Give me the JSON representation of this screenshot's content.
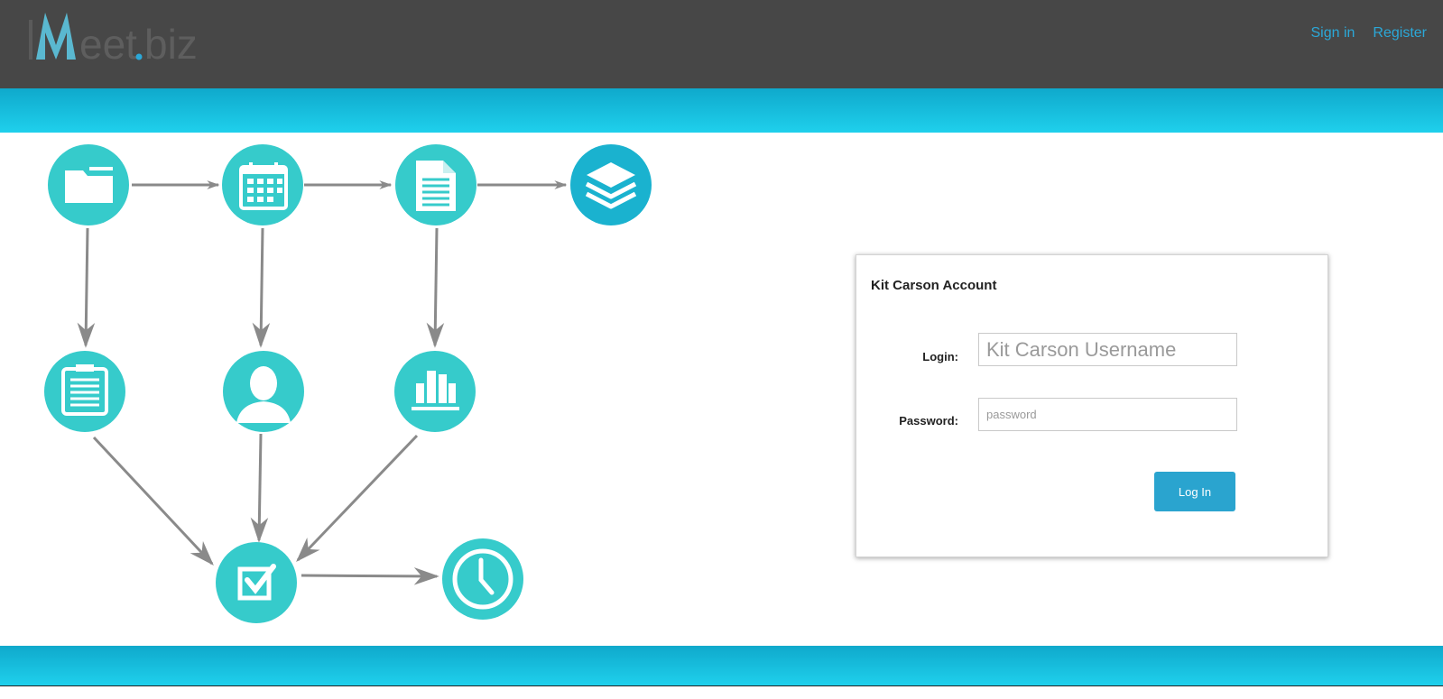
{
  "header": {
    "logo_text": "IMeet.biz",
    "nav": {
      "signin_label": "Sign in",
      "register_label": "Register"
    }
  },
  "diagram": {
    "nodes": [
      {
        "name": "folder-icon"
      },
      {
        "name": "calendar-icon"
      },
      {
        "name": "document-icon"
      },
      {
        "name": "layers-icon"
      },
      {
        "name": "clipboard-icon"
      },
      {
        "name": "user-icon"
      },
      {
        "name": "library-icon"
      },
      {
        "name": "checkbox-icon"
      },
      {
        "name": "clock-icon"
      }
    ],
    "colors": {
      "node": "#36cbcb",
      "node_alt": "#1ab2cf",
      "arrow": "#8a8a8a"
    }
  },
  "login_panel": {
    "title": "Kit Carson Account",
    "login_label": "Login:",
    "login_placeholder": "Kit Carson Username",
    "password_label": "Password:",
    "password_placeholder": "password",
    "submit_label": "Log In"
  },
  "colors": {
    "topbar": "#474747",
    "band": "#1fc8e6",
    "link": "#2ba8d8",
    "button": "#2aa4cf"
  }
}
